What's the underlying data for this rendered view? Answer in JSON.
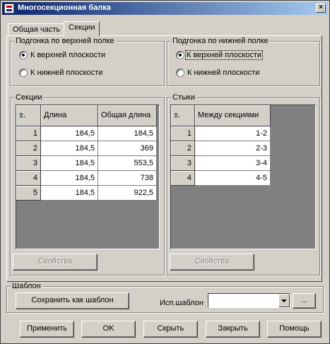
{
  "window": {
    "title": "Многосекционная балка",
    "close_glyph": "×"
  },
  "tabs": [
    {
      "label": "Общая часть",
      "active": false
    },
    {
      "label": "Секции",
      "active": true
    }
  ],
  "upper_fit": {
    "legend": "Подгонка по верхней полке",
    "options": [
      {
        "label": "К верхней плоскости",
        "selected": true
      },
      {
        "label": "К нижней плоскости",
        "selected": false
      }
    ]
  },
  "lower_fit": {
    "legend": "Подгонка по нижней полке",
    "options": [
      {
        "label": "К верхней плоскости",
        "selected": true
      },
      {
        "label": "К нижней плоскости",
        "selected": false
      }
    ]
  },
  "sections": {
    "legend": "Секции",
    "headers": [
      "±.",
      "Длина",
      "Общая длина"
    ],
    "rows": [
      [
        "1",
        "184,5",
        "184,5"
      ],
      [
        "2",
        "184,5",
        "369"
      ],
      [
        "3",
        "184,5",
        "553,5"
      ],
      [
        "4",
        "184,5",
        "738"
      ],
      [
        "5",
        "184,5",
        "922,5"
      ]
    ],
    "properties_label": "Свойства"
  },
  "joints": {
    "legend": "Стыки",
    "headers": [
      "±.",
      "Между секциями"
    ],
    "rows": [
      [
        "1",
        "1-2"
      ],
      [
        "2",
        "2-3"
      ],
      [
        "3",
        "3-4"
      ],
      [
        "4",
        "4-5"
      ]
    ],
    "properties_label": "Свойства"
  },
  "template": {
    "legend": "Шаблон",
    "save_label": "Сохранить как шаблон",
    "use_label": "Исп.шаблон",
    "combo_value": "",
    "browse_label": "..."
  },
  "footer": {
    "apply": "Применить",
    "ok": "OK",
    "hide": "Скрыть",
    "close": "Закрыть",
    "help": "Помощь"
  }
}
